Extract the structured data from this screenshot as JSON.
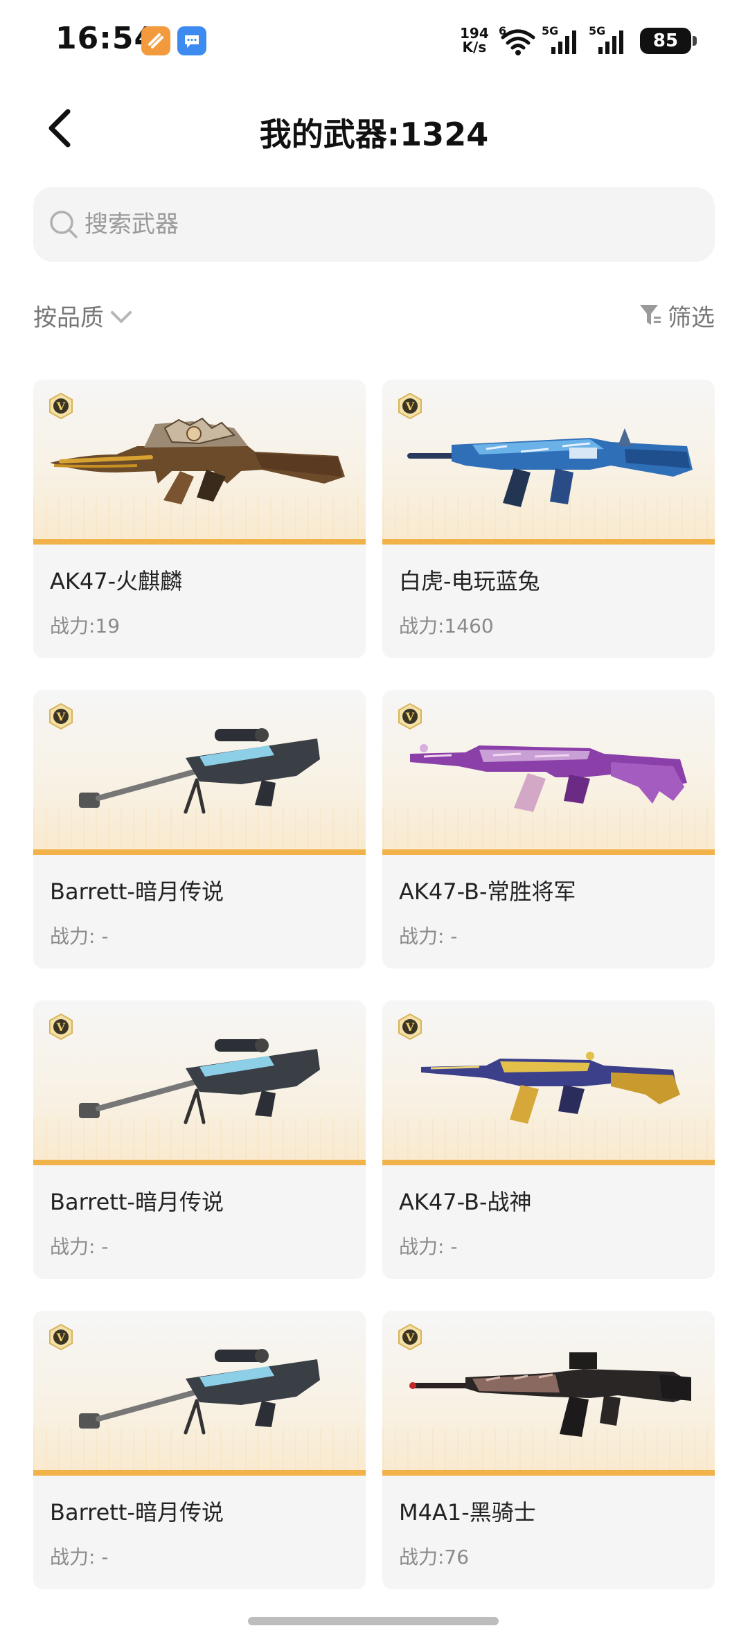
{
  "status_bar": {
    "time": "16:54",
    "net_speed_value": "194",
    "net_speed_unit": "K/s",
    "signal_label_1": "5G",
    "signal_label_2": "5G",
    "wifi_label": "6",
    "battery": "85"
  },
  "header": {
    "title": "我的武器:1324",
    "back_icon": "chevron-left-icon"
  },
  "search": {
    "placeholder": "搜索武器",
    "value": ""
  },
  "toolbar": {
    "sort_label": "按品质",
    "filter_label": "筛选"
  },
  "badge_letter": "V",
  "colors": {
    "accent_stripe": "#f2b24a",
    "card_bg": "#f5f5f5",
    "badge_gold": "#c9a24a"
  },
  "weapons": [
    {
      "name": "AK47-火麒麟",
      "power": "战力:19"
    },
    {
      "name": "白虎-电玩蓝兔",
      "power": "战力:1460"
    },
    {
      "name": "Barrett-暗月传说",
      "power": "战力: -"
    },
    {
      "name": "AK47-B-常胜将军",
      "power": "战力: -"
    },
    {
      "name": "Barrett-暗月传说",
      "power": "战力: -"
    },
    {
      "name": "AK47-B-战神",
      "power": "战力: -"
    },
    {
      "name": "Barrett-暗月传说",
      "power": "战力: -"
    },
    {
      "name": "M4A1-黑骑士",
      "power": "战力:76"
    }
  ]
}
